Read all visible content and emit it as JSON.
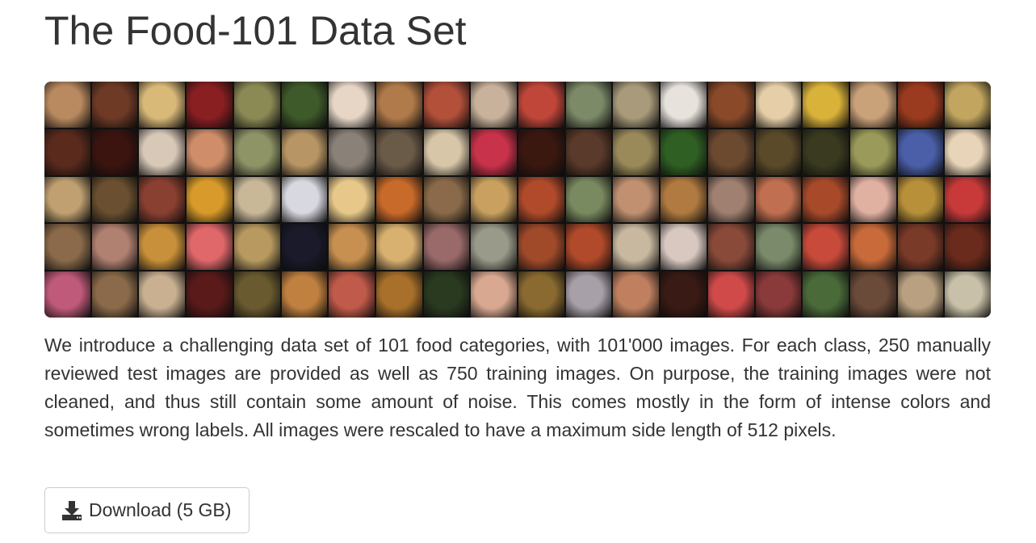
{
  "page": {
    "title": "The Food-101 Data Set",
    "description": "We introduce a challenging data set of 101 food categories, with 101'000 images. For each class, 250 manually reviewed test images are provided as well as 750 training images. On purpose, the training images were not cleaned, and thus still contain some amount of noise. This comes mostly in the form of intense colors and sometimes wrong labels. All images were rescaled to have a maximum side length of 512 pixels."
  },
  "mosaic": {
    "icon": "food-photo-collage",
    "tile_colors": [
      "#b9895f",
      "#6e3a26",
      "#d9b978",
      "#8a1f22",
      "#8b8a55",
      "#3f5a2a",
      "#e7d6c6",
      "#b07a4a",
      "#b2503a",
      "#c9b29c",
      "#c0463a",
      "#7d8a68",
      "#a89a7a",
      "#e8e2dc",
      "#8a4a2a",
      "#e6cfa8",
      "#d9b23a",
      "#caa27a",
      "#9a3b1f",
      "#c2a660",
      "#5a2a1c",
      "#3b1410",
      "#d8c8b8",
      "#cf8d6a",
      "#8e9466",
      "#b79564",
      "#8a8278",
      "#6a5a48",
      "#d8c6a8",
      "#c8324a",
      "#3a1810",
      "#5a3a2a",
      "#9a8a5a",
      "#2f5f23",
      "#6b4a30",
      "#5a4a2a",
      "#3a3a20",
      "#9a9a5a",
      "#4a5fa8",
      "#e8d4b8",
      "#c0a070",
      "#6a5030",
      "#8a4030",
      "#d89a2a",
      "#c8b898",
      "#d8d8e0",
      "#e8c88a",
      "#c86a2a",
      "#8a6a4a",
      "#c9a060",
      "#b04a2a",
      "#7a8a60",
      "#c09070",
      "#b07a40",
      "#a08070",
      "#c07050",
      "#a84a2a",
      "#e0b0a0",
      "#b8903a",
      "#c83a3a",
      "#8a6a4a",
      "#b08070",
      "#c8903a",
      "#e0686a",
      "#b89a60",
      "#1a1a2a",
      "#c89050",
      "#d8b070",
      "#9a6a6a",
      "#9a9a8a",
      "#a04a2a",
      "#b04a2a",
      "#c8b8a0",
      "#d8c8c0",
      "#8a4a3a",
      "#7a8a6a",
      "#c84a3a",
      "#c86a3a",
      "#7a3a28",
      "#6a2a1c",
      "#c05a7a",
      "#8a6a4a",
      "#c8b090",
      "#5a1a1a",
      "#6a5a30",
      "#c08040",
      "#c05a4a",
      "#a8702a",
      "#2a3a20",
      "#d8a890",
      "#8a6a30",
      "#a8a0a8",
      "#c08060",
      "#3a1a14",
      "#d04a4a",
      "#8a3a3a",
      "#4a6a3a",
      "#6a4a38",
      "#b8a080",
      "#c8c0a8"
    ]
  },
  "download": {
    "label": "Download (5 GB)",
    "icon": "download-icon"
  }
}
